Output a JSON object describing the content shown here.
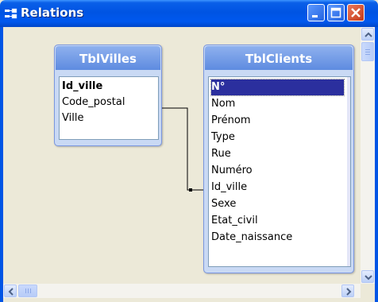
{
  "window": {
    "title": "Relations",
    "icon": "relations-icon",
    "buttons": [
      "minimize-icon",
      "maximize-icon",
      "close-icon"
    ]
  },
  "tables": [
    {
      "name": "TblVilles",
      "fields": [
        "Id_ville",
        "Code_postal",
        "Ville"
      ],
      "key_field": "Id_ville"
    },
    {
      "name": "TblClients",
      "fields": [
        "N°",
        "Nom",
        "Prénom",
        "Type",
        "Rue",
        "Numéro",
        "Id_ville",
        "Sexe",
        "Etat_civil",
        "Date_naissance"
      ],
      "key_field": "N°",
      "selected_field": "N°"
    }
  ],
  "relationship": {
    "from": "TblVilles.Id_ville",
    "to": "TblClients.Id_ville"
  },
  "colors": {
    "titlebar": "#0054E3",
    "background": "#ECE9D8",
    "table_header": "#6E96E4",
    "selection": "#2B2F9E"
  }
}
